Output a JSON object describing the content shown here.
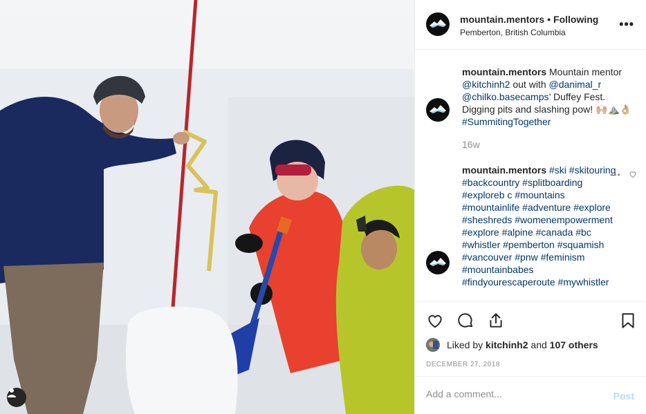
{
  "post": {
    "username": "mountain.mentors",
    "separator": "•",
    "follow_status": "Following",
    "location": "Pemberton, British Columbia",
    "more_icon": "more-options-icon"
  },
  "caption": {
    "username": "mountain.mentors",
    "text_1": "Mountain mentor",
    "mention_1": "@kitchinh2",
    "text_2": "out with",
    "mention_2": "@danimal_r",
    "mention_3": "@chilko.basecamps",
    "text_3": "’ Duffey Fest. Digging pits and slashing pow! 🙌🏼⛰️👌🏼",
    "hashtag": "#SummitingTogether",
    "time_ago": "16w"
  },
  "comment": {
    "username": "mountain.mentors",
    "hashtags": "#ski #skitouring #backcountry #splitboarding #exploreb c #mountains #mountainlife #adventure #explore #sheshreds #womenempowerment #explore #alpine #canada #bc #whistler #pemberton #squamish #vancouver #pnw #feminism #mountainbabes #findyourescaperoute #mywhistler",
    "more": "•••",
    "like_icon": "small-heart-icon"
  },
  "actions": {
    "like_icon": "heart-icon",
    "comment_icon": "comment-icon",
    "share_icon": "share-icon",
    "save_icon": "bookmark-icon"
  },
  "likes": {
    "prefix": "Liked by",
    "user": "kitchinh2",
    "and": "and",
    "others": "107 others"
  },
  "date": "DECEMBER 27, 2018",
  "add_comment": {
    "placeholder": "Add a comment...",
    "post_label": "Post"
  },
  "colors": {
    "link": "#00376b",
    "muted": "#8e8e8e",
    "post_disabled": "#b2dffc"
  }
}
